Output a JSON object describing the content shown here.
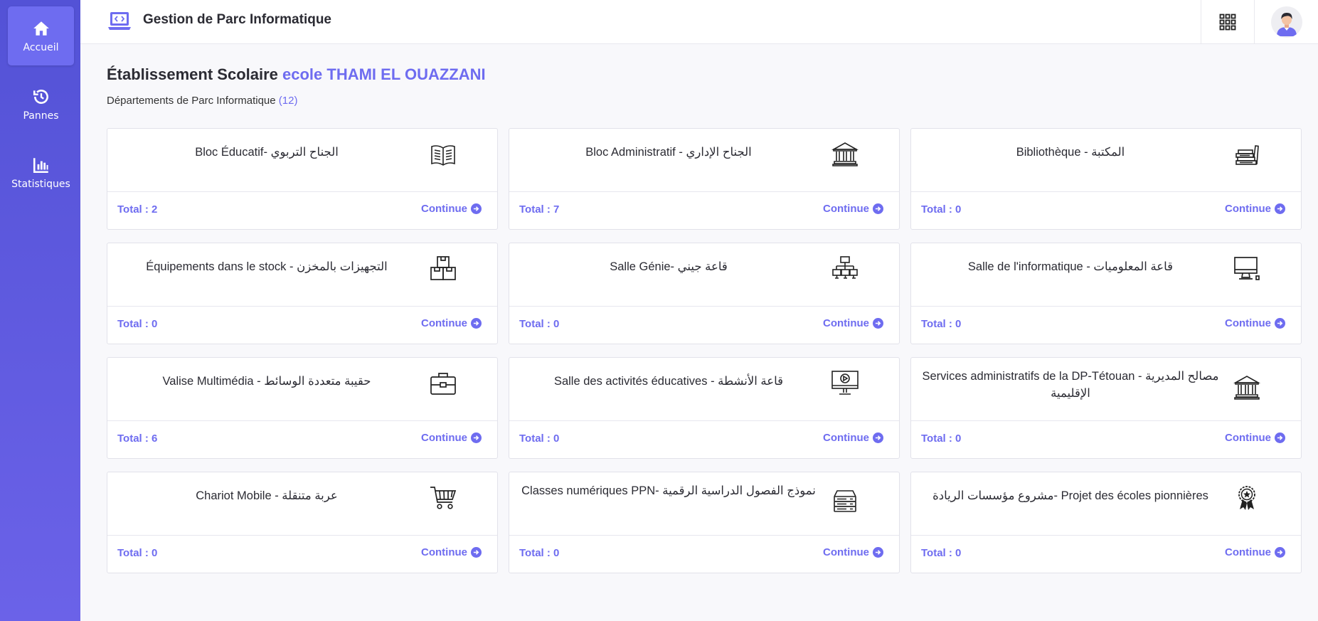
{
  "sidebar": {
    "items": [
      {
        "label": "Accueil",
        "icon": "home-icon",
        "active": true
      },
      {
        "label": "Pannes",
        "icon": "history-icon",
        "active": false
      },
      {
        "label": "Statistiques",
        "icon": "bar-chart-icon",
        "active": false
      }
    ]
  },
  "header": {
    "title": "Gestion de Parc Informatique",
    "logo_icon": "laptop-code-icon",
    "apps_icon": "grid-icon",
    "avatar_icon": "user-avatar-icon"
  },
  "main": {
    "title_prefix": "Établissement Scolaire",
    "school_name": "ecole THAMI EL OUAZZANI",
    "subtitle": "Départements de Parc Informatique",
    "department_count": "(12)",
    "continue_label": "Continue",
    "departments": [
      {
        "label": "Bloc Éducatif- الجناح التربوي",
        "total": "Total : 2",
        "icon": "book-icon"
      },
      {
        "label": "Bloc Administratif - الجناح الإداري",
        "total": "Total : 7",
        "icon": "institution-icon"
      },
      {
        "label": "Bibliothèque - المكتبة",
        "total": "Total : 0",
        "icon": "books-stack-icon"
      },
      {
        "label": "Équipements dans le stock - التجهيزات بالمخزن",
        "total": "Total : 0",
        "icon": "boxes-icon"
      },
      {
        "label": "Salle Génie- قاعة جيني",
        "total": "Total : 0",
        "icon": "network-icon"
      },
      {
        "label": "Salle de l'informatique - قاعة المعلوميات",
        "total": "Total : 0",
        "icon": "computer-icon"
      },
      {
        "label": "Valise Multimédia - حقيبة متعددة الوسائط",
        "total": "Total : 6",
        "icon": "briefcase-icon"
      },
      {
        "label": "Salle des activités éducatives - قاعة الأنشطة",
        "total": "Total : 0",
        "icon": "monitor-play-icon"
      },
      {
        "label": "Services administratifs de la DP-Tétouan - مصالح المديرية الإقليمية",
        "total": "Total : 0",
        "icon": "institution-icon"
      },
      {
        "label": "Chariot Mobile - عربة متنقلة",
        "total": "Total : 0",
        "icon": "cart-icon"
      },
      {
        "label": "Classes numériques PPN- نموذج الفصول الدراسية الرقمية",
        "total": "Total : 0",
        "icon": "server-icon"
      },
      {
        "label": "مشروع مؤسسات الريادة- Projet des écoles pionnières",
        "total": "Total : 0",
        "icon": "award-icon"
      }
    ]
  },
  "colors": {
    "accent": "#6e6cf0",
    "sidebar_top": "#5352d6",
    "sidebar_bottom": "#6b62e8"
  }
}
